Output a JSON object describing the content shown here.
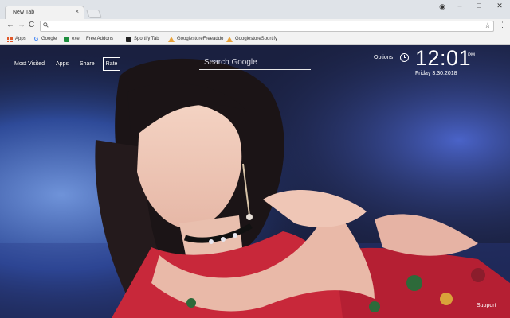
{
  "browser": {
    "tab_title": "New Tab",
    "tab_close": "×",
    "window_controls": {
      "profile": "◉",
      "minimize": "–",
      "maximize": "□",
      "close": "✕"
    },
    "nav": {
      "back": "←",
      "forward": "→",
      "reload": "C"
    },
    "address": {
      "value": "",
      "placeholder": ""
    },
    "star": "☆",
    "menu": "⋮",
    "bookmarks": [
      {
        "label": "Apps",
        "icon": "apps-grid-icon"
      },
      {
        "label": "Google",
        "icon": "google-icon"
      },
      {
        "label": "exel",
        "icon": "sheets-icon"
      },
      {
        "label": "Free Addons",
        "icon": "page-icon"
      },
      {
        "label": "Sportify Tab",
        "icon": "tv-icon"
      },
      {
        "label": "GooglestoreFreeaddo",
        "icon": "drive-icon"
      },
      {
        "label": "GooglestoreSportify",
        "icon": "drive-icon"
      }
    ]
  },
  "newtab": {
    "nav_links": [
      "Most Visited",
      "Apps",
      "Share",
      "Rate"
    ],
    "search": {
      "placeholder": "Search Google",
      "value": ""
    },
    "options_label": "Options",
    "clock": {
      "time": "12:01",
      "ampm": "PM",
      "date": "Friday  3.30.2018"
    },
    "support_label": "Support"
  },
  "colors": {
    "chrome_bg": "#dfe3e8",
    "toolbar_bg": "#f2f2f2",
    "page_bg_dark": "#1a2340",
    "accent_blue": "#3a58b8",
    "dress_red": "#c8283a",
    "ruffle_pink": "#e9b9a8"
  }
}
